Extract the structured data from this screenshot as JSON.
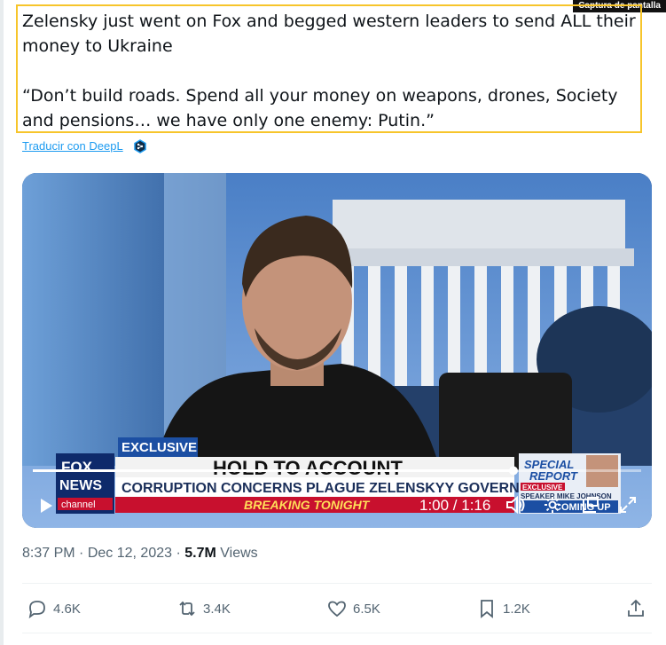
{
  "badge": {
    "label": "Captura de pantalla"
  },
  "tweet": {
    "text_line1": "Zelensky just went on Fox and begged western leaders to send ALL their money to Ukraine",
    "text_line2": "“Don’t build roads. Spend all your money on weapons, drones, Society and pensions… we have only one enemy: Putin.”",
    "translate_label": "Traducir con DeepL"
  },
  "video": {
    "lower_third": {
      "tag": "EXCLUSIVE",
      "headline": "HOLD TO ACCOUNT",
      "subhead": "CORRUPTION CONCERNS PLAGUE ZELENSKYY GOVERNMENT",
      "ticker": "BREAKING TONIGHT",
      "logo_top": "FOX",
      "logo_mid": "NEWS",
      "logo_bot": "channel",
      "promo_top": "SPECIAL",
      "promo_bot": "REPORT",
      "promo_tag": "EXCLUSIVE",
      "promo_name": "SPEAKER MIKE JOHNSON",
      "promo_coming": "COMING UP"
    },
    "time": "1:00 / 1:16",
    "progress": 0.79
  },
  "meta": {
    "time": "8:37 PM",
    "sep1": "·",
    "date": "Dec 12, 2023",
    "sep2": "·",
    "views_count": "5.7M",
    "views_label": "Views"
  },
  "actions": {
    "replies": "4.6K",
    "reposts": "3.4K",
    "likes": "6.5K",
    "bookmarks": "1.2K"
  },
  "colors": {
    "accent": "#1d9bf0",
    "highlight_box": "#f7c52b",
    "muted": "#536471"
  }
}
